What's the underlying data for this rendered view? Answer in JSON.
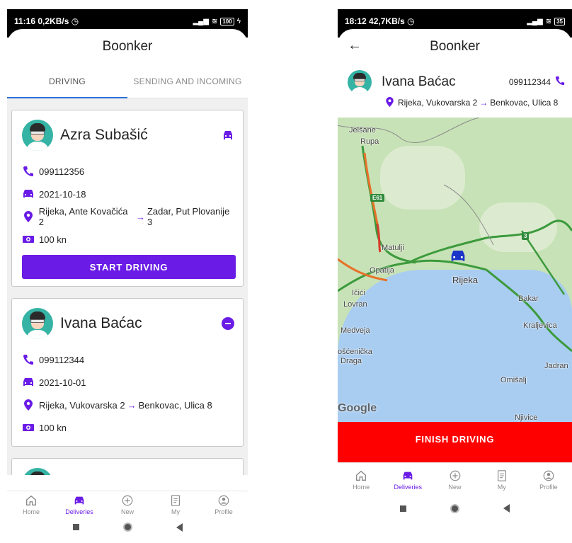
{
  "left": {
    "status": {
      "time": "11:16",
      "speed": "0,2KB/s",
      "battery": "100"
    },
    "app_title": "Boonker",
    "tabs": [
      {
        "label": "DRIVING",
        "active": true
      },
      {
        "label": "SENDING AND INCOMING",
        "active": false
      }
    ],
    "cards": [
      {
        "name": "Azra Subašić",
        "phone": "099112356",
        "date": "2021-10-18",
        "from": "Rijeka, Ante Kovačića 2",
        "to": "Zadar, Put Plovanije 3",
        "price": "100 kn",
        "action_icon": "car-icon",
        "button": "START DRIVING"
      },
      {
        "name": "Ivana Baćac",
        "phone": "099112344",
        "date": "2021-10-01",
        "from": "Rijeka, Vukovarska 2",
        "to": "Benkovac, Ulica 8",
        "price": "100 kn",
        "action_icon": "minus-circle-icon"
      }
    ],
    "nav": [
      {
        "label": "Home",
        "icon": "home-icon",
        "active": false
      },
      {
        "label": "Deliveries",
        "icon": "car-icon",
        "active": true
      },
      {
        "label": "New",
        "icon": "plus-circle-icon",
        "active": false
      },
      {
        "label": "My",
        "icon": "document-icon",
        "active": false
      },
      {
        "label": "Profile",
        "icon": "profile-icon",
        "active": false
      }
    ]
  },
  "right": {
    "status": {
      "time": "18:12",
      "speed": "42,7KB/s",
      "battery": "35"
    },
    "app_title": "Boonker",
    "detail": {
      "name": "Ivana Baćac",
      "phone": "099112344",
      "from": "Rijeka, Vukovarska 2",
      "to": "Benkovac, Ulica 8"
    },
    "map_labels": {
      "jelsane": "Jelšane",
      "rupa": "Rupa",
      "e61": "E61",
      "route3": "3",
      "matulji": "Matulji",
      "opatija": "Opatija",
      "rijeka": "Rijeka",
      "icici": "Ičići",
      "lovran": "Lovran",
      "bakar": "Bakar",
      "medveja": "Medveja",
      "kraljevica": "Kraljevica",
      "moscenicka": "ošćenička",
      "draga": "Draga",
      "jadran": "Jadran",
      "omisalj": "Omišalj",
      "njivice": "Njivice",
      "google": "Google"
    },
    "finish_button": "FINISH DRIVING",
    "nav": [
      {
        "label": "Home",
        "icon": "home-icon",
        "active": false
      },
      {
        "label": "Deliveries",
        "icon": "car-icon",
        "active": true
      },
      {
        "label": "New",
        "icon": "plus-circle-icon",
        "active": false
      },
      {
        "label": "My",
        "icon": "document-icon",
        "active": false
      },
      {
        "label": "Profile",
        "icon": "profile-icon",
        "active": false
      }
    ]
  },
  "colors": {
    "accent": "#6a1ce6",
    "finish": "#ff0000",
    "tab_indicator": "#2f6fd6",
    "map_land": "#c7e2b6",
    "map_sea": "#a9cdf1"
  }
}
